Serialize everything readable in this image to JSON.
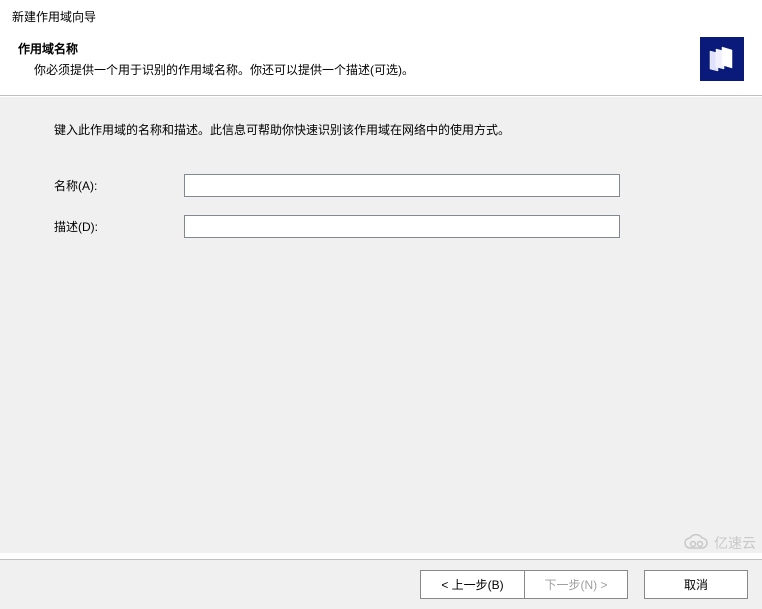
{
  "window": {
    "title": "新建作用域向导"
  },
  "header": {
    "title": "作用域名称",
    "subtitle": "你必须提供一个用于识别的作用域名称。你还可以提供一个描述(可选)。",
    "icon_name": "scope-folder-icon"
  },
  "content": {
    "instruction": "键入此作用域的名称和描述。此信息可帮助你快速识别该作用域在网络中的使用方式。"
  },
  "form": {
    "name": {
      "label": "名称(A):",
      "value": ""
    },
    "description": {
      "label": "描述(D):",
      "value": ""
    }
  },
  "buttons": {
    "back": "< 上一步(B)",
    "next": "下一步(N) >",
    "cancel": "取消"
  },
  "watermark": {
    "text": "亿速云"
  }
}
